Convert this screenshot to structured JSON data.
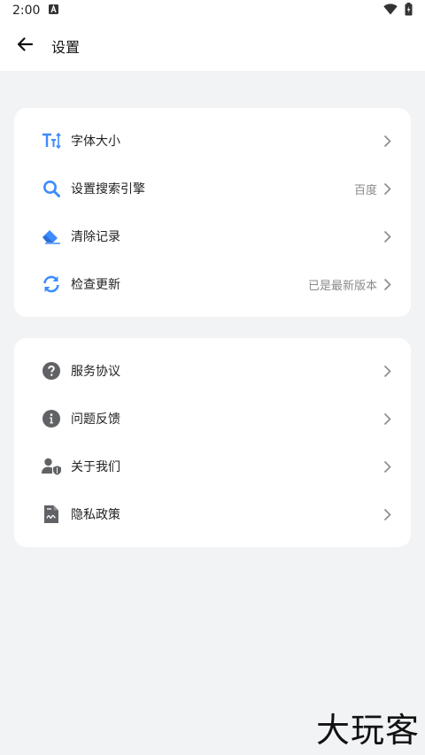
{
  "status_bar": {
    "time": "2:00",
    "icons": [
      "notification-a-icon",
      "wifi-icon",
      "battery-icon"
    ]
  },
  "app_bar": {
    "back_icon": "arrow-left-icon",
    "title": "设置"
  },
  "group1": [
    {
      "label": "字体大小",
      "value": "",
      "icon": "font-size-icon"
    },
    {
      "label": "设置搜索引擎",
      "value": "百度",
      "icon": "search-icon"
    },
    {
      "label": "清除记录",
      "value": "",
      "icon": "eraser-icon"
    },
    {
      "label": "检查更新",
      "value": "已是最新版本",
      "icon": "refresh-icon"
    }
  ],
  "group2": [
    {
      "label": "服务协议",
      "value": "",
      "icon": "question-icon"
    },
    {
      "label": "问题反馈",
      "value": "",
      "icon": "info-icon"
    },
    {
      "label": "关于我们",
      "value": "",
      "icon": "user-shield-icon"
    },
    {
      "label": "隐私政策",
      "value": "",
      "icon": "document-icon"
    }
  ],
  "colors": {
    "accent_blue": "#3d8bff",
    "icon_gray": "#606266",
    "background": "#f2f3f5"
  },
  "watermark": "大玩客"
}
